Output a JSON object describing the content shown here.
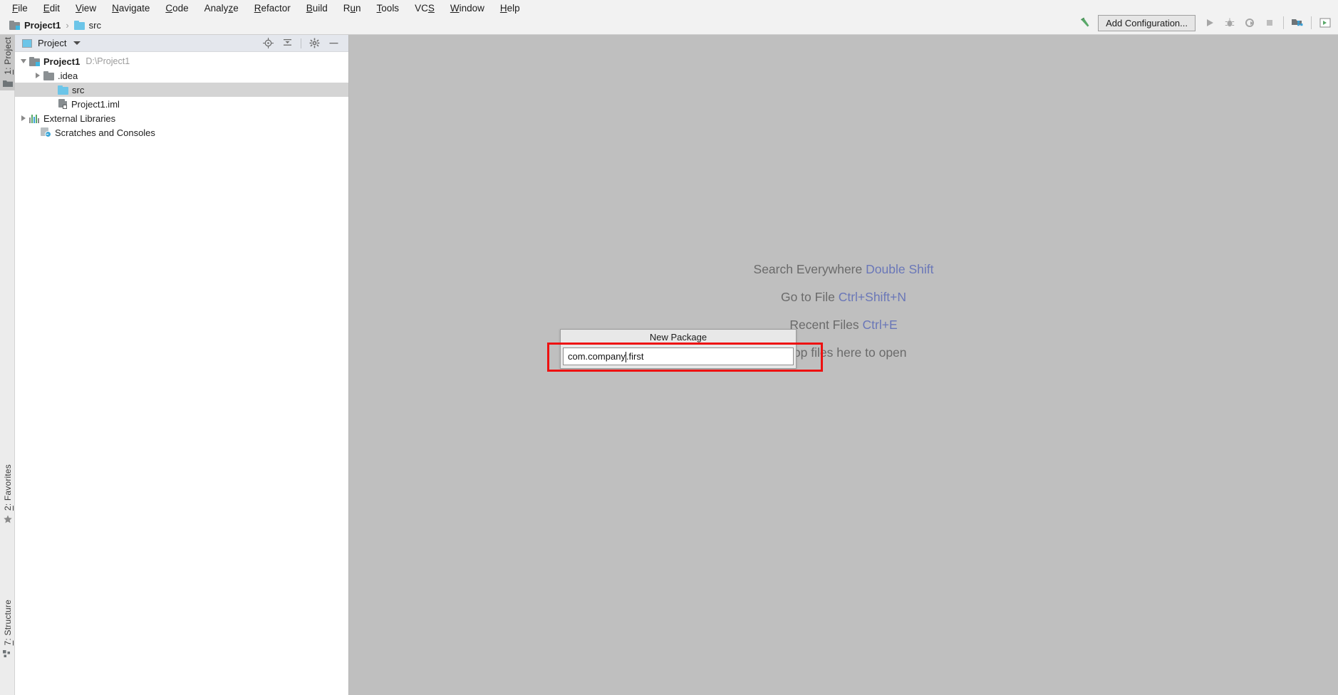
{
  "menubar": {
    "items": [
      {
        "label": "File",
        "mnemonic": "F"
      },
      {
        "label": "Edit",
        "mnemonic": "E"
      },
      {
        "label": "View",
        "mnemonic": "V"
      },
      {
        "label": "Navigate",
        "mnemonic": "N"
      },
      {
        "label": "Code",
        "mnemonic": "C"
      },
      {
        "label": "Analyze",
        "mnemonic": "z"
      },
      {
        "label": "Refactor",
        "mnemonic": "R"
      },
      {
        "label": "Build",
        "mnemonic": "B"
      },
      {
        "label": "Run",
        "mnemonic": "u"
      },
      {
        "label": "Tools",
        "mnemonic": "T"
      },
      {
        "label": "VCS",
        "mnemonic": "S"
      },
      {
        "label": "Window",
        "mnemonic": "W"
      },
      {
        "label": "Help",
        "mnemonic": "H"
      }
    ]
  },
  "navbar": {
    "project_name": "Project1",
    "separator": "›",
    "folder_name": "src",
    "project_icon": "module-icon",
    "folder_icon": "folder-icon"
  },
  "toolbar": {
    "build_icon": "hammer-icon",
    "run_config_label": "Add Configuration...",
    "run_icon": "run-icon",
    "debug_icon": "debug-icon",
    "run_coverage_icon": "run-with-coverage-icon",
    "stop_icon": "stop-icon",
    "project_structure_icon": "project-structure-icon",
    "search_icon": "search-everywhere-icon"
  },
  "stripe": {
    "buttons": [
      {
        "label": "1: Project",
        "mnemonic": "1",
        "icon": "project-folder-icon",
        "active": true
      },
      {
        "label": "2: Favorites",
        "mnemonic": "2",
        "icon": "star-icon",
        "active": false
      },
      {
        "label": "7: Structure",
        "mnemonic": "7",
        "icon": "structure-icon",
        "active": false
      }
    ]
  },
  "project_panel": {
    "header": {
      "title": "Project",
      "view_icon": "project-view-icon",
      "dropdown_icon": "chevron-down-icon",
      "tools": [
        {
          "name": "locate-icon",
          "title": "Select Opened File"
        },
        {
          "name": "collapse-all-icon",
          "title": "Collapse All"
        },
        {
          "name": "gear-icon",
          "title": "Settings"
        },
        {
          "name": "minimize-icon",
          "title": "Hide"
        }
      ]
    },
    "tree": [
      {
        "label": "Project1",
        "sub": "D:\\Project1",
        "icon": "module-icon",
        "indent": 0,
        "twisty": "down",
        "bold": true,
        "selected": false
      },
      {
        "label": ".idea",
        "sub": "",
        "icon": "folder-grey-icon",
        "indent": 1,
        "twisty": "right",
        "bold": false,
        "selected": false
      },
      {
        "label": "src",
        "sub": "",
        "icon": "folder-icon",
        "indent": 2,
        "twisty": "none",
        "bold": false,
        "selected": true
      },
      {
        "label": "Project1.iml",
        "sub": "",
        "icon": "iml-file-icon",
        "indent": 2,
        "twisty": "none",
        "bold": false,
        "selected": false
      },
      {
        "label": "External Libraries",
        "sub": "",
        "icon": "libraries-icon",
        "indent": 0,
        "twisty": "right",
        "bold": false,
        "selected": false
      },
      {
        "label": "Scratches and Consoles",
        "sub": "",
        "icon": "scratches-icon",
        "indent": 0,
        "twisty": "none",
        "bold": false,
        "selected": false
      }
    ]
  },
  "editor": {
    "hints": [
      {
        "action": "Search Everywhere",
        "shortcut": "Double Shift"
      },
      {
        "action": "Go to File",
        "shortcut": "Ctrl+Shift+N"
      },
      {
        "action": "Recent Files",
        "shortcut": "Ctrl+E"
      },
      {
        "action": "Drop files here to open",
        "shortcut": ""
      }
    ]
  },
  "new_package_dialog": {
    "title": "New Package",
    "input_value_before_caret": "com.company",
    "input_value_after_caret": ".first",
    "full_value": "com.company.first"
  },
  "annotation": {
    "highlight_color": "#ee1111"
  },
  "colors": {
    "accent_blue": "#6cc5e8",
    "hint_key": "#6a77b8",
    "editor_bg": "#bfbfbf",
    "panel_header_bg": "#e4e7ed",
    "selection_bg": "#d4d4d4"
  }
}
